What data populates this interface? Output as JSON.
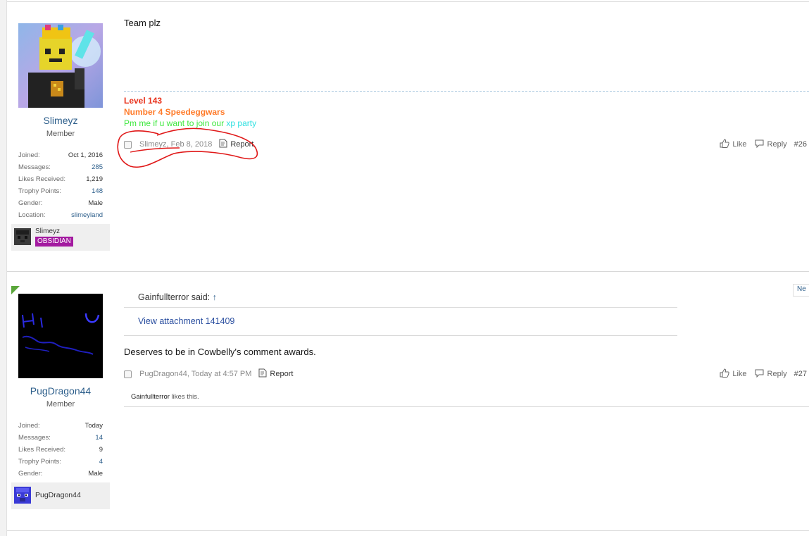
{
  "posts": [
    {
      "username": "Slimeyz",
      "user_title": "Member",
      "stats": [
        {
          "k": "Joined:",
          "v": "Oct 1, 2016"
        },
        {
          "k": "Messages:",
          "v": "285"
        },
        {
          "k": "Likes Received:",
          "v": "1,219"
        },
        {
          "k": "Trophy Points:",
          "v": "148"
        },
        {
          "k": "Gender:",
          "v": "Male"
        },
        {
          "k": "Location:",
          "v": "slimeyland"
        }
      ],
      "extra": {
        "name": "Slimeyz",
        "rank": "OBSIDIAN"
      },
      "message": "Team plz",
      "signature": {
        "line1": "Level 143",
        "line2": "Number 4 Speedeggwars",
        "line3a": "Pm me if u want to join our",
        "line3b": "xp party"
      },
      "meta": "Slimeyz, Feb 8, 2018",
      "report": "Report",
      "like": "Like",
      "reply": "Reply",
      "number": "#26"
    },
    {
      "username": "PugDragon44",
      "user_title": "Member",
      "stats": [
        {
          "k": "Joined:",
          "v": "Today"
        },
        {
          "k": "Messages:",
          "v": "14"
        },
        {
          "k": "Likes Received:",
          "v": "9"
        },
        {
          "k": "Trophy Points:",
          "v": "4"
        },
        {
          "k": "Gender:",
          "v": "Male"
        }
      ],
      "extra": {
        "name": "PugDragon44"
      },
      "new_badge": "Ne",
      "quote": {
        "author": "Gainfullterror said:",
        "arrow": "↑",
        "attachment": "View attachment 141409"
      },
      "message": "Deserves to be in Cowbelly's comment awards.",
      "meta": "PugDragon44, Today at 4:57 PM",
      "report": "Report",
      "like": "Like",
      "reply": "Reply",
      "number": "#27",
      "likes_summary": {
        "name": "Gainfullterror",
        "rest": " likes this."
      }
    }
  ],
  "colors": {
    "username": "#2b5d8a",
    "sig_red": "#e8311b",
    "sig_orange": "#ff7b2a",
    "sig_green": "#3ee83e",
    "sig_cyan": "#2ee0e0",
    "rank_badge": "#a31aa0",
    "annotation": "#e01818"
  }
}
